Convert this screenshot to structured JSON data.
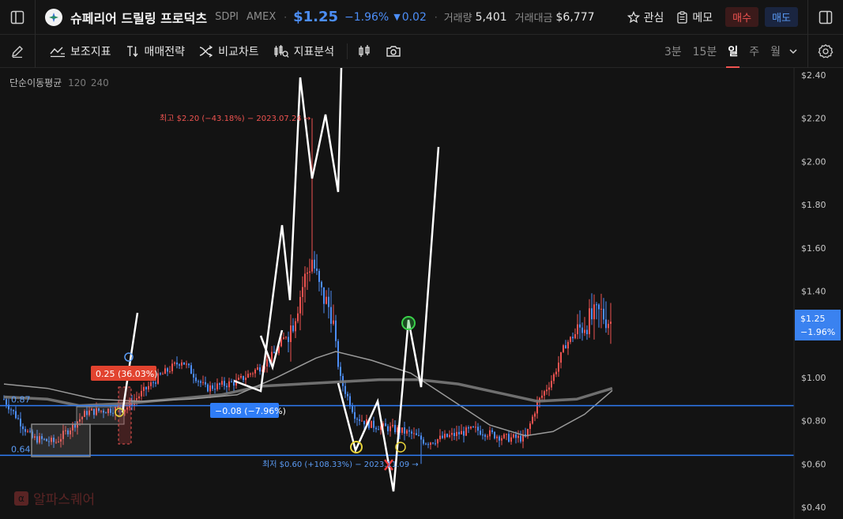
{
  "header": {
    "name": "슈페리어 드릴링 프로덕츠",
    "ticker": "SDPI",
    "exchange": "AMEX",
    "price": "$1.25",
    "change_pct": "−1.96%",
    "change_abs": "0.02",
    "volume_label": "거래량",
    "volume": "5,401",
    "turnover_label": "거래대금",
    "turnover": "$6,777",
    "watch_label": "관심",
    "memo_label": "메모",
    "buy_label": "매수",
    "sell_label": "매도"
  },
  "toolbar": {
    "indicators_label": "보조지표",
    "strategy_label": "매매전략",
    "compare_label": "비교차트",
    "analysis_label": "지표분석",
    "timeframes": [
      "3분",
      "15분",
      "일",
      "주",
      "월"
    ],
    "active_timeframe": "일"
  },
  "legend": {
    "ma_label": "단순이동평균",
    "ma_period_1": "120",
    "ma_period_2": "240"
  },
  "chart_data": {
    "type": "candlestick",
    "y_ticks": [
      "$2.40",
      "$2.20",
      "$2.00",
      "$1.80",
      "$1.60",
      "$1.40",
      "$1.20",
      "$1.00",
      "$0.80",
      "$0.60",
      "$0.40"
    ],
    "ylim": [
      0.4,
      2.4
    ],
    "current_price_tag": "$1.25",
    "current_change_tag": "−1.96%",
    "horizontal_levels": [
      {
        "label": "0.87",
        "value": 0.87
      },
      {
        "label": "0.64",
        "value": 0.64
      }
    ],
    "annotations": {
      "high": "최고 $2.20 (−43.18%) − 2023.07.24 →",
      "low": "최저 $0.60 (+108.33%) − 2023.11.09 →",
      "gain_tag": "0.25 (36.03%)",
      "loss_tag": "−0.08 (−7.96%)"
    },
    "colors": {
      "up": "#ef5350",
      "down": "#4c8ef7",
      "ma120": "#9a9a9a",
      "ma240": "#7a7a7a",
      "levels": "#2f7df6"
    }
  },
  "watermark": {
    "text": "알파스퀘어"
  }
}
